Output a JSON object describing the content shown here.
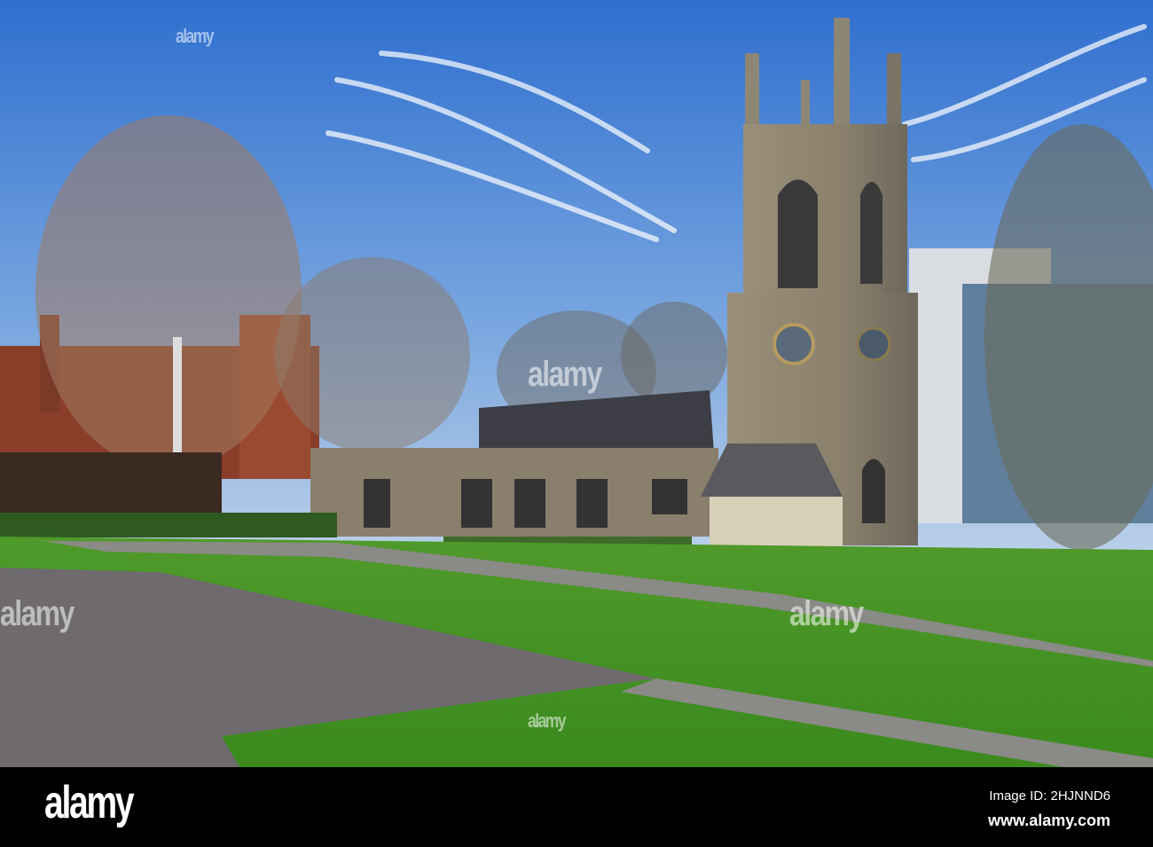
{
  "watermark": "alamy",
  "footer": {
    "logo": "alamy",
    "image_id": "Image ID: 2HJNND6",
    "website": "www.alamy.com"
  }
}
